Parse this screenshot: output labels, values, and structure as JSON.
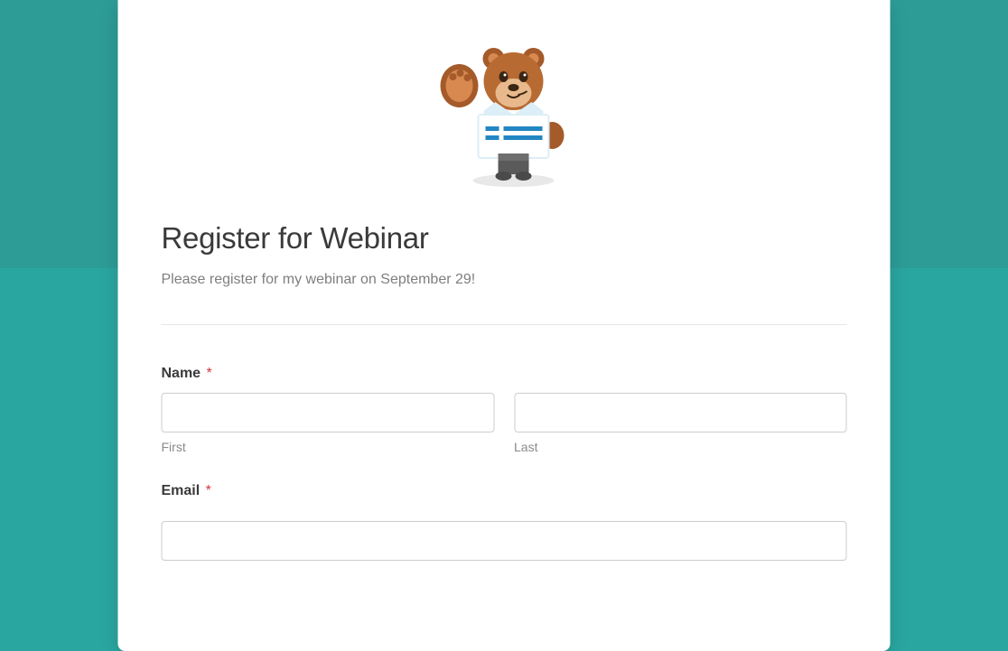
{
  "form": {
    "title": "Register for Webinar",
    "description": "Please register for my webinar on September 29!",
    "required_marker": "*",
    "fields": {
      "name": {
        "label": "Name",
        "first_sublabel": "First",
        "last_sublabel": "Last",
        "first_value": "",
        "last_value": ""
      },
      "email": {
        "label": "Email",
        "value": ""
      }
    }
  },
  "colors": {
    "background": "#2aa6a0",
    "stripe": "#2d9c97",
    "card": "#ffffff",
    "title": "#3a3a3a",
    "description": "#7e7e7e",
    "required": "#d63638",
    "border": "#cccccc",
    "sublabel": "#8a8a8a"
  }
}
